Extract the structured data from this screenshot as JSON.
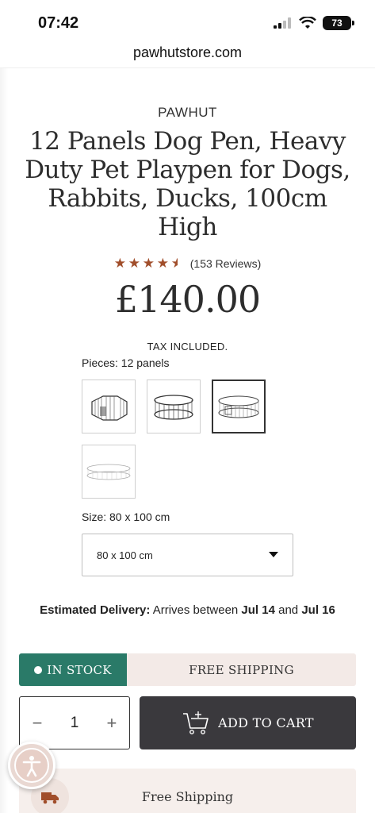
{
  "status_bar": {
    "time": "07:42",
    "battery": "73"
  },
  "browser": {
    "url": "pawhutstore.com"
  },
  "product": {
    "brand": "PAWHUT",
    "title": "12 Panels Dog Pen, Heavy Duty Pet Playpen for Dogs, Rabbits, Ducks, 100cm High",
    "rating": 4.5,
    "reviews": "(153 Reviews)",
    "price": "£140.00",
    "tax_note": "TAX INCLUDED."
  },
  "pieces": {
    "label": "Pieces: 12 panels",
    "options": [
      {
        "name": "8-panel-pen",
        "selected": false
      },
      {
        "name": "10-panel-pen",
        "selected": false
      },
      {
        "name": "12-panel-pen",
        "selected": true
      },
      {
        "name": "16-panel-pen",
        "selected": false
      }
    ]
  },
  "size": {
    "label": "Size: 80 x 100 cm",
    "selected": "80 x 100 cm"
  },
  "delivery": {
    "label": "Estimated Delivery:",
    "text_before": " Arrives between ",
    "start": "Jul 14",
    "middle": " and ",
    "end": "Jul 16"
  },
  "stock": {
    "status": "IN STOCK",
    "shipping": "FREE SHIPPING",
    "status_color": "#2a7a68"
  },
  "cart": {
    "quantity": "1",
    "minus": "−",
    "plus": "+",
    "add_label": "ADD TO CART",
    "button_color": "#3a393d"
  },
  "bottom": {
    "free_shipping": "Free Shipping"
  },
  "icons": {
    "cart": "cart-plus-icon",
    "truck": "truck-icon",
    "accessibility": "accessibility-icon",
    "star": "star-icon"
  }
}
